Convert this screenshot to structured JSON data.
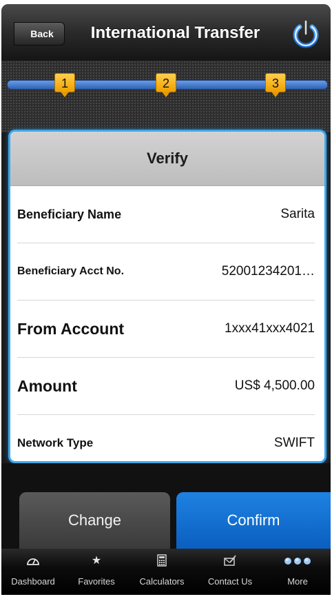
{
  "header": {
    "back_label": "Back",
    "title": "International Transfer"
  },
  "progress": {
    "steps": [
      "1",
      "2",
      "3"
    ],
    "current_step": 3
  },
  "card": {
    "title": "Verify",
    "rows": [
      {
        "label": "Beneficiary Name",
        "value": "Sarita"
      },
      {
        "label": "Beneficiary Acct No.",
        "value": "52001234201…"
      },
      {
        "label": "From Account",
        "value": "1xxx41xxx4021"
      },
      {
        "label": "Amount",
        "value": "US$ 4,500.00"
      },
      {
        "label": "Network Type",
        "value": "SWIFT"
      }
    ]
  },
  "actions": {
    "change_label": "Change",
    "confirm_label": "Confirm"
  },
  "tabbar": {
    "items": [
      {
        "label": "Dashboard",
        "icon": "gauge-icon"
      },
      {
        "label": "Favorites",
        "icon": "star-icon"
      },
      {
        "label": "Calculators",
        "icon": "calculator-icon"
      },
      {
        "label": "Contact Us",
        "icon": "contact-icon"
      },
      {
        "label": "More",
        "icon": "more-icon"
      }
    ]
  },
  "colors": {
    "accent_blue": "#0a5fc0",
    "step_badge": "#f0a000",
    "card_border": "#3fa7ea"
  }
}
